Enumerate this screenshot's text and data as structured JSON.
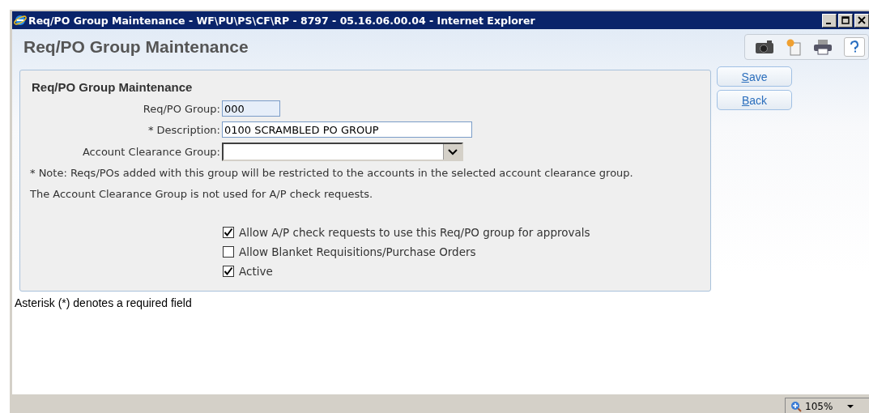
{
  "window": {
    "title": "Req/PO Group Maintenance - WF\\PU\\PS\\CF\\RP - 8797 - 05.16.06.00.04 - Internet Explorer"
  },
  "page_title": "Req/PO Group Maintenance",
  "form": {
    "heading": "Req/PO Group Maintenance",
    "fields": [
      {
        "kind": "readonly",
        "label": "Req/PO Group:",
        "value": "000"
      },
      {
        "kind": "text",
        "label": "* Description:",
        "value": "0100 SCRAMBLED PO GROUP"
      },
      {
        "kind": "select",
        "label": "Account Clearance Group:"
      }
    ],
    "notes": [
      "* Note: Reqs/POs added with this group will be restricted to the accounts in the selected account clearance group.",
      "The Account Clearance Group is not used for A/P check requests."
    ],
    "checkboxes": [
      {
        "label": "Allow A/P check requests to use this Req/PO group for approvals",
        "checked": true
      },
      {
        "label": "Allow Blanket Requisitions/Purchase Orders",
        "checked": false
      },
      {
        "label": "Active",
        "checked": true
      }
    ]
  },
  "buttons": [
    "Save",
    "Back"
  ],
  "footnote": "Asterisk (*) denotes a required field",
  "status_bar": {
    "zoom": "105%"
  }
}
